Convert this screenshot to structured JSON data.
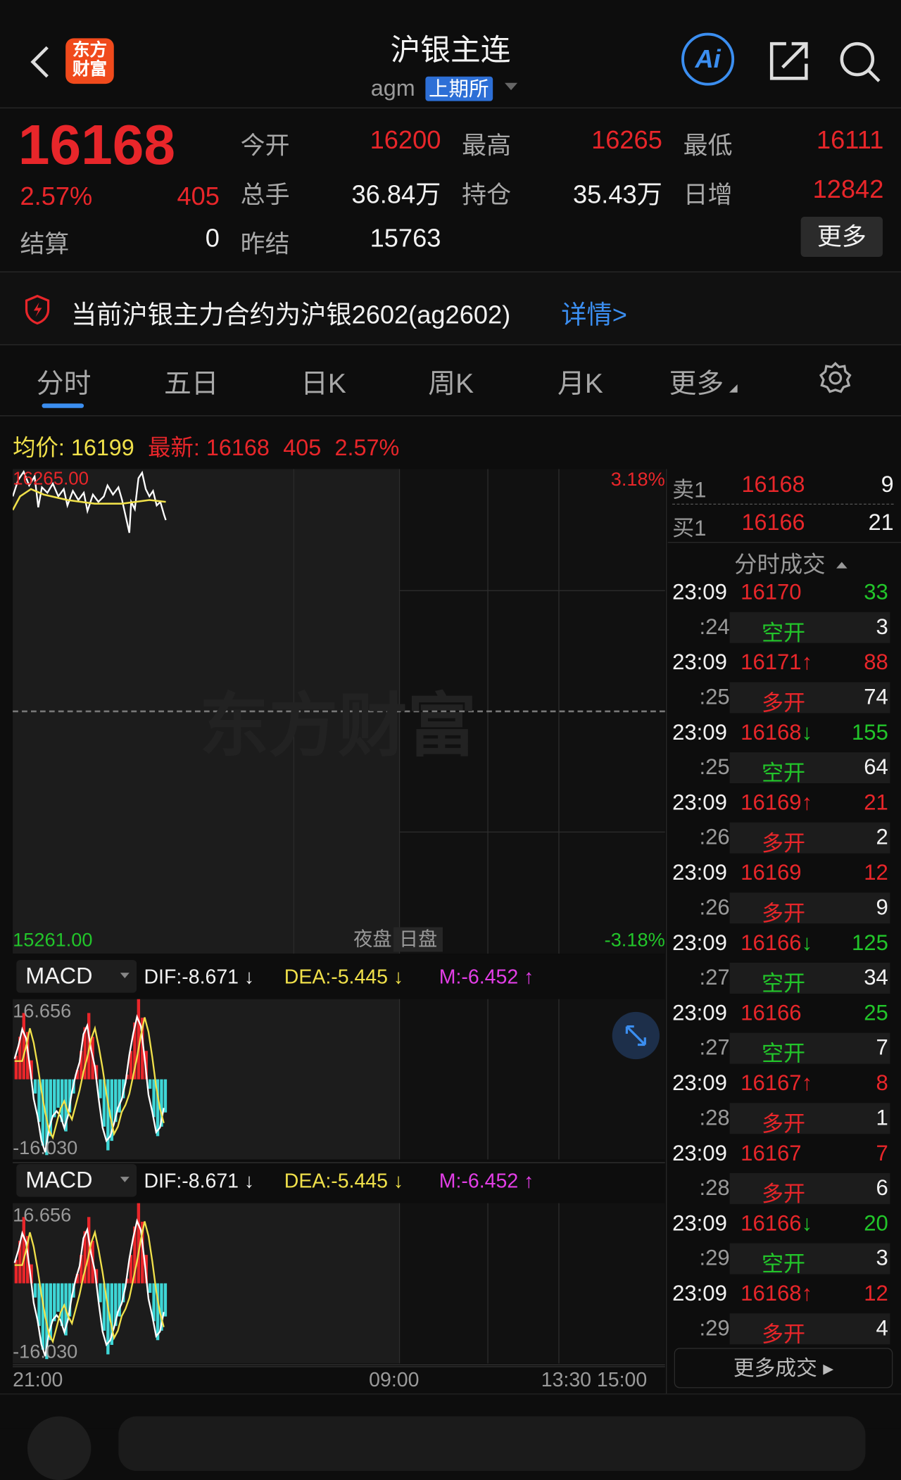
{
  "header": {
    "title": "沪银主连",
    "code": "agm",
    "exchange": "上期所",
    "logo_text": "东方财富",
    "ai_label": "Ai"
  },
  "quote": {
    "price": "16168",
    "change_pct": "2.57%",
    "change": "405",
    "settle_label": "结算",
    "settle": "0",
    "fields": [
      {
        "label": "今开",
        "value": "16200",
        "color": "red"
      },
      {
        "label": "最高",
        "value": "16265",
        "color": "red"
      },
      {
        "label": "最低",
        "value": "16111",
        "color": "red"
      },
      {
        "label": "总手",
        "value": "36.84万",
        "color": "white"
      },
      {
        "label": "持仓",
        "value": "35.43万",
        "color": "white"
      },
      {
        "label": "日增",
        "value": "12842",
        "color": "red"
      },
      {
        "label": "昨结",
        "value": "15763",
        "color": "white"
      }
    ],
    "more": "更多"
  },
  "notice": {
    "text": "当前沪银主力合约为沪银2602(ag2602)",
    "link": "详情>"
  },
  "tabs": [
    "分时",
    "五日",
    "日K",
    "周K",
    "月K",
    "更多"
  ],
  "info": {
    "avg_label": "均价:",
    "avg": "16199",
    "last_label": "最新:",
    "last": "16168",
    "chg": "405",
    "pct": "2.57%"
  },
  "chart": {
    "top": "16265.00",
    "bottom": "15261.00",
    "top_pct": "3.18%",
    "bottom_pct": "-3.18%",
    "night": "夜盘",
    "day": "日盘",
    "watermark": "东方财富",
    "xlabels": [
      "21:00",
      "09:00",
      "13:30 15:00"
    ]
  },
  "book": {
    "sell_label": "卖1",
    "sell_price": "16168",
    "sell_vol": "9",
    "buy_label": "买1",
    "buy_price": "16166",
    "buy_vol": "21",
    "trades_title": "分时成交",
    "more_trades": "更多成交",
    "trades": [
      {
        "time": "23:09",
        "price": "16170",
        "arrow": "",
        "vol": "33",
        "vc": "green",
        "sec": ":24",
        "kind": "空开",
        "kc": "green",
        "kvol": "3"
      },
      {
        "time": "23:09",
        "price": "16171",
        "arrow": "↑",
        "vol": "88",
        "vc": "red",
        "sec": ":25",
        "kind": "多开",
        "kc": "red",
        "kvol": "74"
      },
      {
        "time": "23:09",
        "price": "16168",
        "arrow": "↓",
        "vol": "155",
        "vc": "green",
        "sec": ":25",
        "kind": "空开",
        "kc": "green",
        "kvol": "64"
      },
      {
        "time": "23:09",
        "price": "16169",
        "arrow": "↑",
        "vol": "21",
        "vc": "red",
        "sec": ":26",
        "kind": "多开",
        "kc": "red",
        "kvol": "2"
      },
      {
        "time": "23:09",
        "price": "16169",
        "arrow": "",
        "vol": "12",
        "vc": "red",
        "sec": ":26",
        "kind": "多开",
        "kc": "red",
        "kvol": "9"
      },
      {
        "time": "23:09",
        "price": "16166",
        "arrow": "↓",
        "vol": "125",
        "vc": "green",
        "sec": ":27",
        "kind": "空开",
        "kc": "green",
        "kvol": "34"
      },
      {
        "time": "23:09",
        "price": "16166",
        "arrow": "",
        "vol": "25",
        "vc": "green",
        "sec": ":27",
        "kind": "空开",
        "kc": "green",
        "kvol": "7"
      },
      {
        "time": "23:09",
        "price": "16167",
        "arrow": "↑",
        "vol": "8",
        "vc": "red",
        "sec": ":28",
        "kind": "多开",
        "kc": "red",
        "kvol": "1"
      },
      {
        "time": "23:09",
        "price": "16167",
        "arrow": "",
        "vol": "7",
        "vc": "red",
        "sec": ":28",
        "kind": "多开",
        "kc": "red",
        "kvol": "6"
      },
      {
        "time": "23:09",
        "price": "16166",
        "arrow": "↓",
        "vol": "20",
        "vc": "green",
        "sec": ":29",
        "kind": "空开",
        "kc": "green",
        "kvol": "3"
      },
      {
        "time": "23:09",
        "price": "16168",
        "arrow": "↑",
        "vol": "12",
        "vc": "red",
        "sec": ":29",
        "kind": "多开",
        "kc": "red",
        "kvol": "4"
      }
    ]
  },
  "macd": {
    "name": "MACD",
    "dif": "DIF:-8.671 ↓",
    "dea": "DEA:-5.445 ↓",
    "m": "M:-6.452 ↑",
    "max": "16.656",
    "min": "-16.030"
  },
  "colors": {
    "red": "#e8262a",
    "green": "#22c52a",
    "yellow": "#f0e04a",
    "blue": "#3b8ef0",
    "cyan": "#3ed6d6"
  }
}
